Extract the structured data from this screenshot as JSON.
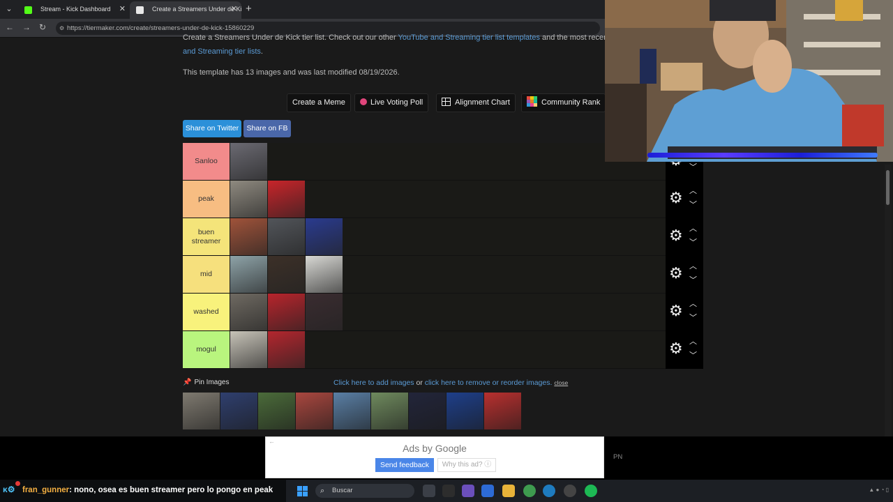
{
  "browser": {
    "tabs": [
      {
        "label": "Stream - Kick Dashboard",
        "fav_color": "#53fc18"
      },
      {
        "label": "Create a Streamers Under de Kick T",
        "fav_color": "#e8e8e8"
      }
    ],
    "url_host": "tiermaker.com",
    "url_path": "/create/streamers-under-de-kick-15860229"
  },
  "page": {
    "intro_line1_pre": "Create a Streamers Under de Kick tier list. Check out our other ",
    "intro_line1_link": "YouTube and Streaming tier list templates",
    "intro_line1_post": " and the most recen",
    "intro_line2_link": "and Streaming tier lists",
    "intro_line2_post": ".",
    "template_info": "This template has 13 images and was last modified 08/19/2026.",
    "buttons": {
      "meme": "Create a Meme",
      "poll": "Live Voting Poll",
      "alignment": "Alignment Chart",
      "community": "Community Rank"
    },
    "share": {
      "twitter": "Share on Twitter",
      "fb": "Share on FB"
    },
    "tiers": [
      {
        "label": "Sanloo",
        "color": "#f28b8b",
        "items": [
          "#6b6a72"
        ]
      },
      {
        "label": "peak",
        "color": "#f7bd82",
        "items": [
          "#8f8a80",
          "#c8242a"
        ]
      },
      {
        "label": "buen streamer",
        "color": "#f4e47a",
        "items": [
          "#a0533a",
          "#52555a",
          "#2a3b8f"
        ]
      },
      {
        "label": "mid",
        "color": "#f6e07d",
        "items": [
          "#8ea3a8",
          "#3c3028",
          "#d8d8d4"
        ]
      },
      {
        "label": "washed",
        "color": "#f8f27c",
        "items": [
          "#6f6a62",
          "#b8242c",
          "#3a2c30"
        ]
      },
      {
        "label": "mogul",
        "color": "#b9f57e",
        "items": [
          "#c7c3b8",
          "#b4262e"
        ]
      }
    ],
    "pin_label": "Pin Images",
    "add_link": "Click here to add images",
    "or_text": " or ",
    "reorder_link": "click here to remove or reorder images.",
    "close_label": "close",
    "pool_items": [
      "#7f7a70",
      "#2f3f6e",
      "#4b6b3a",
      "#a9473f",
      "#5a7fa5",
      "#6f8a5e",
      "#22253a",
      "#1e3f8a",
      "#b8302f"
    ]
  },
  "ad": {
    "title": "Ads by Google",
    "feedback": "Send feedback",
    "why": "Why this ad? ⓘ",
    "side_text": "PN"
  },
  "chat": {
    "user": "fran_gunner",
    "message": ": nono, osea es buen streamer pero lo pongo en peak"
  },
  "taskbar": {
    "search_placeholder": "Buscar"
  }
}
